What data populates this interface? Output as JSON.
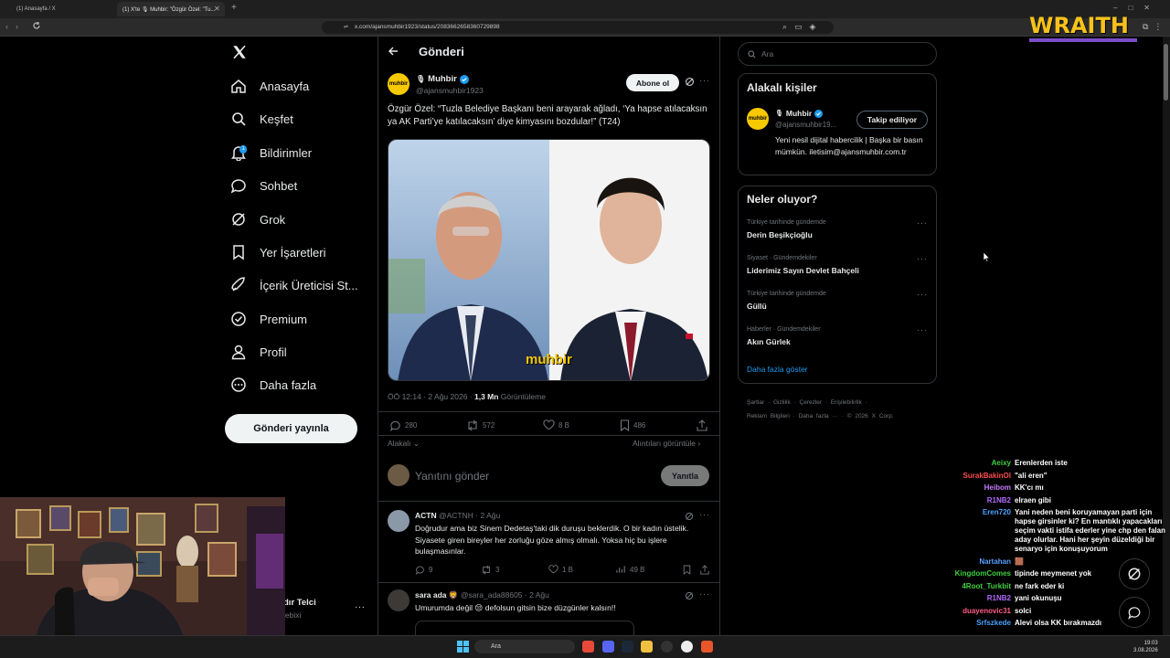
{
  "browser": {
    "tabs": [
      {
        "label": "(1) Anasayfa / X"
      },
      {
        "label": "(1) X'te 🎙 Muhbir: \"Özgür Özel: \"Tu..."
      }
    ],
    "url": "x.com/ajansmuhbir1923/status/2083662658360729898"
  },
  "overlay": {
    "brand": "WRAITH"
  },
  "nav": {
    "items": [
      {
        "label": "Anasayfa",
        "icon": "home-icon"
      },
      {
        "label": "Keşfet",
        "icon": "search-icon"
      },
      {
        "label": "Bildirimler",
        "icon": "bell-icon",
        "badge": "1"
      },
      {
        "label": "Sohbet",
        "icon": "chat-icon"
      },
      {
        "label": "Grok",
        "icon": "grok-icon"
      },
      {
        "label": "Yer İşaretleri",
        "icon": "bookmark-icon"
      },
      {
        "label": "İçerik Üreticisi St...",
        "icon": "rocket-icon"
      },
      {
        "label": "Premium",
        "icon": "premium-icon"
      },
      {
        "label": "Profil",
        "icon": "profile-icon"
      },
      {
        "label": "Daha fazla",
        "icon": "more-icon"
      }
    ],
    "post_button": "Gönderi yayınla",
    "account": {
      "name": "dır Telci",
      "handle": "lebixi"
    }
  },
  "header": {
    "title": "Gönderi"
  },
  "post": {
    "author_name": "Muhbir",
    "author_handle": "@ajansmuhbir1923",
    "subscribe": "Abone ol",
    "text": "Özgür Özel: “Tuzla Belediye Başkanı beni arayarak ağladı, ‘Ya hapse atılacaksın ya AK Parti’ye katılacaksın’ diye kimyasını bozdular!” (T24)",
    "image_watermark": "muhbir",
    "time": "ÖÖ 12:14 · 2 Ağu 2026 · ",
    "views_count": "1,3 Mn",
    "views_label": " Görüntüleme",
    "replies": "280",
    "reposts": "572",
    "likes": "8 B",
    "bookmarks": "486",
    "sort_label": "Alakalı",
    "quotes_link": "Alıntıları görüntüle"
  },
  "compose": {
    "placeholder": "Yanıtını gönder",
    "button": "Yanıtla"
  },
  "replies": [
    {
      "name": "ACTN",
      "handle": "@ACTNH · 2 Ağu",
      "text": "Doğrudur ama biz Sinem Dedetaş'taki dik duruşu beklerdik. O bir kadın üstelik. Siyasete giren bireyler her zorluğu göze almış olmalı. Yoksa hiç bu işlere bulaşmasınlar.",
      "replies": "9",
      "reposts": "3",
      "likes": "1 B",
      "views": "49 B"
    },
    {
      "name": "sara ada 🦁",
      "handle": "@sara_ada88605 · 2 Ağu",
      "text": "Umurumda değil 😒 defolsun gitsin bize düzgünler kalsın!!"
    }
  ],
  "search": {
    "placeholder": "Ara"
  },
  "related": {
    "title": "Alakalı kişiler",
    "name": "Muhbir",
    "handle": "@ajansmuhbir19...",
    "follow_button": "Takip ediliyor",
    "bio": "Yeni nesil dijital habercilik | Başka bir basın mümkün. iletisim@ajansmuhbir.com.tr"
  },
  "trends": {
    "title": "Neler oluyor?",
    "items": [
      {
        "category": "Türkiye tarihinde gündemde",
        "name": "Derin Beşikçioğlu"
      },
      {
        "category": "Siyaset · Gündemdekiler",
        "name": "Liderimiz Sayın Devlet Bahçeli"
      },
      {
        "category": "Türkiye tarihinde gündemde",
        "name": "Güllü"
      },
      {
        "category": "Haberler · Gündemdekiler",
        "name": "Akın Gürlek"
      }
    ],
    "show_more": "Daha fazla göster"
  },
  "footer": {
    "links": [
      "Şartlar",
      "Gizlilik",
      "Çerezler",
      "Erişilebilirlik",
      "Reklam Bilgileri",
      "Daha fazla ···",
      "© 2026 X Corp."
    ]
  },
  "stream_chat": [
    {
      "user": "Aeixy",
      "msg": "Erenlerden iste",
      "color": "#3fd13f"
    },
    {
      "user": "SurakBakinOl",
      "msg": "\"ali eren\"",
      "color": "#ff4d4d"
    },
    {
      "user": "Heibom",
      "msg": "KK'cı mı",
      "color": "#c77dff"
    },
    {
      "user": "R1NB2",
      "msg": "elraen gibi",
      "color": "#b36bff"
    },
    {
      "user": "Eren720",
      "msg": "Yani neden beni koruyamayan parti için hapse girsinler ki? En mantıklı yapacakları seçim vakti istifa ederler yine chp den falan aday olurlar. Hani her şeyin düzeldiği bir senaryo için konuşuyorum",
      "color": "#4aa3ff"
    },
    {
      "user": "Nartahan",
      "msg": "🟫",
      "color": "#5aa0ff"
    },
    {
      "user": "KingdomComes",
      "msg": "tipinde meymenet yok",
      "color": "#3fd13f"
    },
    {
      "user": "4Root_Turkbit",
      "msg": "ne fark eder ki",
      "color": "#3fd13f"
    },
    {
      "user": "R1NB2",
      "msg": "yani okunuşu",
      "color": "#b36bff"
    },
    {
      "user": "duayenovic31",
      "msg": "solci",
      "color": "#ff5c8a"
    },
    {
      "user": "Srfszkede",
      "msg": "Alevi olsa KK bırakmazdı",
      "color": "#4aa3ff"
    }
  ],
  "taskbar": {
    "search": "Ara",
    "time": "19:03",
    "date": "3.08.2026"
  }
}
